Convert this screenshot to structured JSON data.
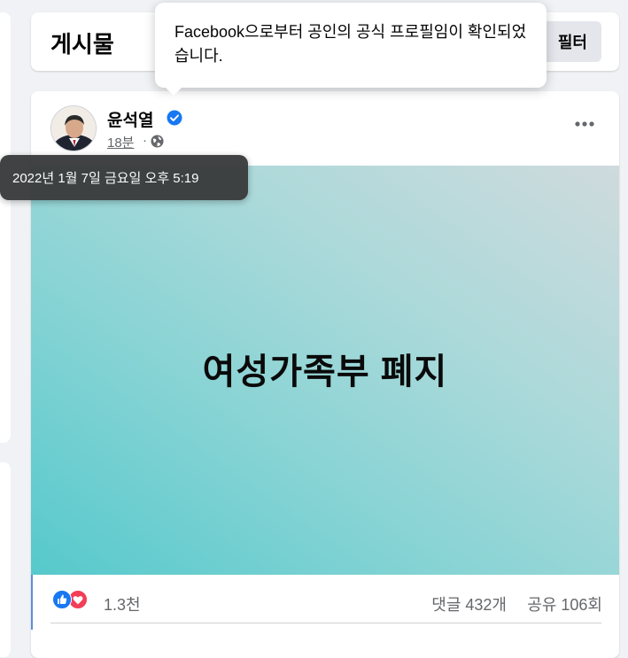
{
  "header": {
    "title": "게시물",
    "filter_label": "필터"
  },
  "post": {
    "author": "윤석열",
    "time": "18분",
    "separator": "·",
    "image_text": "여성가족부 폐지"
  },
  "reactions": {
    "count": "1.3천",
    "comments": "댓글 432개",
    "shares": "공유 106회"
  },
  "tooltips": {
    "verified_text": "Facebook으로부터 공인의 공식 프로필임이 확인되었습니다.",
    "timestamp_text": "2022년 1월 7일 금요일 오후 5:19"
  },
  "colors": {
    "facebook_blue": "#1877f2",
    "love_red": "#f33e58",
    "text_secondary": "#65676b"
  },
  "icons": [
    "verified-badge-icon",
    "globe-icon",
    "more-options-icon",
    "like-reaction-icon",
    "love-reaction-icon"
  ]
}
